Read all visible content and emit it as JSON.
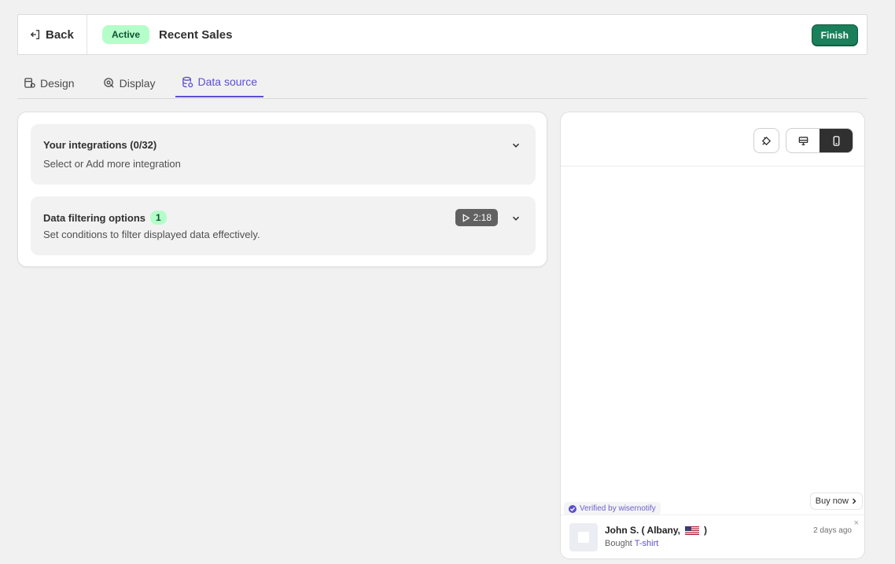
{
  "header": {
    "back_label": "Back",
    "status": "Active",
    "title": "Recent Sales",
    "finish_label": "Finish"
  },
  "tabs": [
    {
      "label": "Design",
      "icon": "design-icon"
    },
    {
      "label": "Display",
      "icon": "display-icon"
    },
    {
      "label": "Data source",
      "icon": "database-icon",
      "active": true
    }
  ],
  "cards": {
    "integrations": {
      "title": "Your integrations (0/32)",
      "subtitle": "Select or Add more integration"
    },
    "filtering": {
      "title": "Data filtering options",
      "badge": "1",
      "subtitle": "Set conditions to filter displayed data effectively.",
      "video_duration": "2:18"
    }
  },
  "preview": {
    "device_active": "mobile",
    "buy_now": "Buy now",
    "verified": "Verified by wisernotify",
    "name": "John S. ( Albany,",
    "name_suffix": ")",
    "bought_prefix": "Bought",
    "product": "T-shirt",
    "time": "2 days ago",
    "close": "×"
  },
  "colors": {
    "accent": "#5c4fd1",
    "finish": "#1a7f5a",
    "badge_bg": "#b4fec9"
  }
}
